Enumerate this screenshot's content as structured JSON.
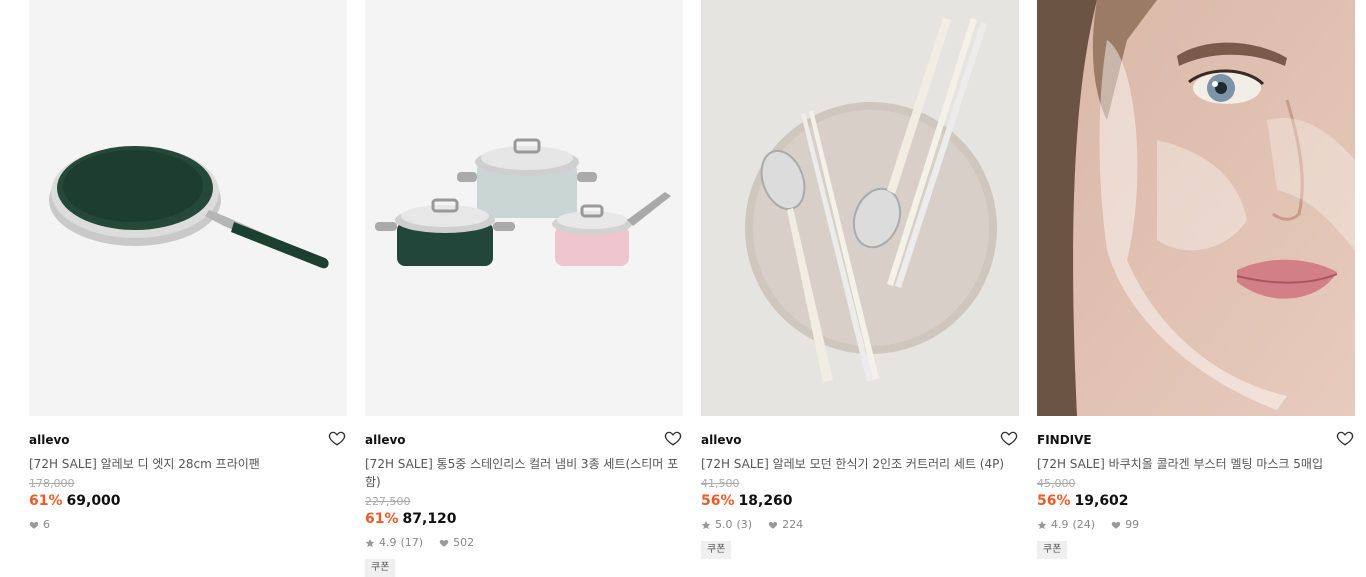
{
  "products": [
    {
      "image_icon": "frying-pan-image",
      "brand": "allevo",
      "title": "[72H SALE] 알레보 디 엣지 28cm 프라이팬",
      "original_price": "178,000",
      "discount": "61%",
      "price": "69,000",
      "rating": "",
      "reviews": "",
      "likes": "6",
      "coupon": ""
    },
    {
      "image_icon": "cookware-set-image",
      "brand": "allevo",
      "title": "[72H SALE] 통5중 스테인리스 컬러 냄비 3종 세트(스티머 포함)",
      "original_price": "227,500",
      "discount": "61%",
      "price": "87,120",
      "rating": "4.9",
      "reviews": "(17)",
      "likes": "502",
      "coupon": "쿠폰"
    },
    {
      "image_icon": "cutlery-set-image",
      "brand": "allevo",
      "title": "[72H SALE] 알레보 모던 한식기 2인조 커트러리 세트 (4P)",
      "original_price": "41,500",
      "discount": "56%",
      "price": "18,260",
      "rating": "5.0",
      "reviews": "(3)",
      "likes": "224",
      "coupon": "쿠폰"
    },
    {
      "image_icon": "face-mask-image",
      "brand": "FINDIVE",
      "title": "[72H SALE] 바쿠치올 콜라겐 부스터 멜팅 마스크 5매입",
      "original_price": "45,000",
      "discount": "56%",
      "price": "19,602",
      "rating": "4.9",
      "reviews": "(24)",
      "likes": "99",
      "coupon": "쿠폰"
    }
  ],
  "colors": {
    "discount": "#f05a28",
    "brand": "#111111",
    "muted": "#888888"
  }
}
